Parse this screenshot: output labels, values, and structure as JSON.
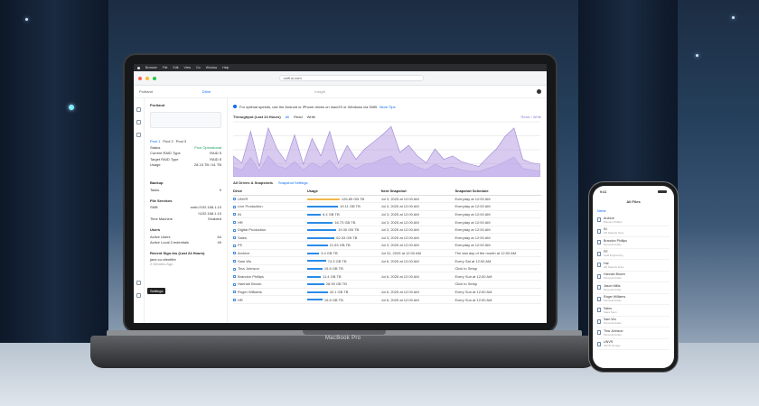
{
  "device": {
    "laptop_label": "MacBook Pro"
  },
  "menubar": [
    "Browser",
    "File",
    "Edit",
    "View",
    "Go",
    "Window",
    "Help"
  ],
  "browser": {
    "url": "unifi.ui.com"
  },
  "app": {
    "site": "Portland",
    "tab": "Drive",
    "page_title": "Insight"
  },
  "notice": {
    "text": "For optimal speeds, use the Android or iPhone drives on macOS or Windows via SMB",
    "link": "More Tips"
  },
  "sidebar": {
    "device": "Portland",
    "pool_tabs": [
      "Pool 1",
      "Pool 2",
      "Pool 3"
    ],
    "stats": [
      {
        "label": "Status",
        "value": "Pool Operational"
      },
      {
        "label": "Current RAID Type",
        "value": "RAID 5"
      },
      {
        "label": "Target RAID Type",
        "value": "RAID 5"
      },
      {
        "label": "Usage",
        "value": "28.15 TB / 61 TB"
      }
    ],
    "backup_title": "Backup",
    "backup_rows": [
      {
        "label": "Tasks",
        "value": "0"
      }
    ],
    "services_title": "File Services",
    "services": [
      {
        "label": "SMB",
        "value": "smb://192.168.1.10"
      },
      {
        "label": "",
        "value": "\\\\192.168.1.10"
      },
      {
        "label": "Time Machine",
        "value": "Enabled"
      }
    ],
    "users_title": "Users",
    "users": [
      {
        "label": "Active Users",
        "value": "64"
      },
      {
        "label": "Active Local Credentials",
        "value": "49"
      }
    ],
    "signin_title": "Recent Sign-Ins (Last 24 Hours)",
    "signin_user": "jane.co.clientfire",
    "signin_time": "2 Minutes Ago",
    "tooltip": "Settings"
  },
  "chart": {
    "title": "Throughput (Last 24 Hours)",
    "ranges": [
      "All",
      "Read",
      "Write"
    ],
    "legend": "Read • Write"
  },
  "chart_data": {
    "type": "area",
    "series": [
      {
        "name": "Read",
        "values": [
          30,
          20,
          65,
          15,
          70,
          40,
          22,
          60,
          18,
          55,
          30,
          65,
          20,
          45,
          25,
          40,
          50,
          60,
          72,
          35,
          45,
          30,
          20,
          40,
          25,
          30,
          22,
          18,
          15,
          28,
          40,
          58,
          70,
          25,
          20,
          18
        ]
      },
      {
        "name": "Write",
        "values": [
          14,
          10,
          28,
          8,
          30,
          16,
          12,
          22,
          10,
          20,
          14,
          24,
          10,
          18,
          12,
          18,
          20,
          26,
          30,
          16,
          20,
          14,
          10,
          18,
          12,
          14,
          10,
          8,
          8,
          12,
          16,
          22,
          28,
          12,
          10,
          8
        ]
      }
    ],
    "ylim": [
      0,
      80
    ],
    "ylabel": "",
    "xlabel": ""
  },
  "drives": {
    "tabs": [
      "All Drives & Snapshots",
      "Snapshot Settings"
    ],
    "headers": [
      "Drive",
      "Usage",
      "Next Snapshot",
      "Snapshot Schedule"
    ],
    "rows": [
      {
        "name": "UNVR",
        "usage": "126.89 GB TB",
        "fill": 0.95,
        "color": "#f2b84b",
        "next": "Jul 3, 2025 at 12:00 AM",
        "schedule": "Everyday at 12:00 AM"
      },
      {
        "name": "Live Production",
        "usage": "19.11 GB TB",
        "fill": 0.9,
        "color": "#2a8be8",
        "next": "Jul 3, 2025 at 12:00 AM",
        "schedule": "Everyday at 12:00 AM"
      },
      {
        "name": "IN",
        "usage": "6.4 GB TB",
        "fill": 0.4,
        "color": "#2a8be8",
        "next": "Jul 3, 2025 at 12:00 AM",
        "schedule": "Everyday at 12:00 AM"
      },
      {
        "name": "HR",
        "usage": "16.73 GB TB",
        "fill": 0.75,
        "color": "#2a8be8",
        "next": "Jul 3, 2025 at 12:00 AM",
        "schedule": "Everyday at 12:00 AM"
      },
      {
        "name": "Digital Production",
        "usage": "19.30 GB TB",
        "fill": 0.85,
        "color": "#2a8be8",
        "next": "Jul 3, 2025 at 12:00 AM",
        "schedule": "Everyday at 12:00 AM"
      },
      {
        "name": "Sales",
        "usage": "62.33 GB TB",
        "fill": 0.8,
        "color": "#2a8be8",
        "next": "Jul 3, 2025 at 12:00 AM",
        "schedule": "Everyday at 12:00 AM"
      },
      {
        "name": "FE",
        "usage": "21.53 GB TB",
        "fill": 0.6,
        "color": "#2a8be8",
        "next": "Jul 3, 2025 at 12:00 AM",
        "schedule": "Everyday at 12:00 AM"
      },
      {
        "name": "Archive",
        "usage": "3.4 GB TB",
        "fill": 0.35,
        "color": "#2a8be8",
        "next": "Jul 31, 2025 at 12:00 AM",
        "schedule": "The last day of the month at 12:00 AM"
      },
      {
        "name": "Sam Wu",
        "usage": "74.3 GB TB",
        "fill": 0.55,
        "color": "#2a8be8",
        "next": "Jul 6, 2025 at 12:00 AM",
        "schedule": "Every Sat at 12:00 AM"
      },
      {
        "name": "Tina Johnson",
        "usage": "15.6 GB TB",
        "fill": 0.45,
        "color": "#2a8be8",
        "next": "",
        "schedule": "Click to Setup"
      },
      {
        "name": "Brandon Phillips",
        "usage": "11.4 GB TB",
        "fill": 0.4,
        "color": "#2a8be8",
        "next": "Jul 6, 2025 at 12:00 AM",
        "schedule": "Every Sun at 12:00 AM"
      },
      {
        "name": "Hannah Brown",
        "usage": "28.90 GB TB",
        "fill": 0.5,
        "color": "#2a8be8",
        "next": "",
        "schedule": "Click to Setup"
      },
      {
        "name": "Roger Williams",
        "usage": "42.1 GB TB",
        "fill": 0.6,
        "color": "#2a8be8",
        "next": "Jul 6, 2025 at 12:00 AM",
        "schedule": "Every Sun at 12:00 AM"
      },
      {
        "name": "HR",
        "usage": "15.8 GB TB",
        "fill": 0.45,
        "color": "#2a8be8",
        "next": "Jul 6, 2025 at 12:00 AM",
        "schedule": "Every Sun at 12:00 AM"
      }
    ]
  },
  "phone": {
    "time": "9:41",
    "title": "All Files",
    "section": "Name",
    "items": [
      {
        "name": "Archive",
        "sub": "Brandon Phillips"
      },
      {
        "name": "IN",
        "sub": "HR Network Drive"
      },
      {
        "name": "Brandon Phillips",
        "sub": "Personal Folder"
      },
      {
        "name": "FE",
        "sub": "Field Engineering"
      },
      {
        "name": "Hal",
        "sub": "HR Network Drive"
      },
      {
        "name": "Hannah Brown",
        "sub": "Personal Folder"
      },
      {
        "name": "Jason Millis",
        "sub": "Personal Folder"
      },
      {
        "name": "Roger Williams",
        "sub": "Personal Folder"
      },
      {
        "name": "Sales",
        "sub": "Sales Team"
      },
      {
        "name": "Sam Wu",
        "sub": "Personal Folder"
      },
      {
        "name": "Tina Johnson",
        "sub": "Personal Folder"
      },
      {
        "name": "UNVR",
        "sub": "UNVR Storage"
      }
    ]
  }
}
